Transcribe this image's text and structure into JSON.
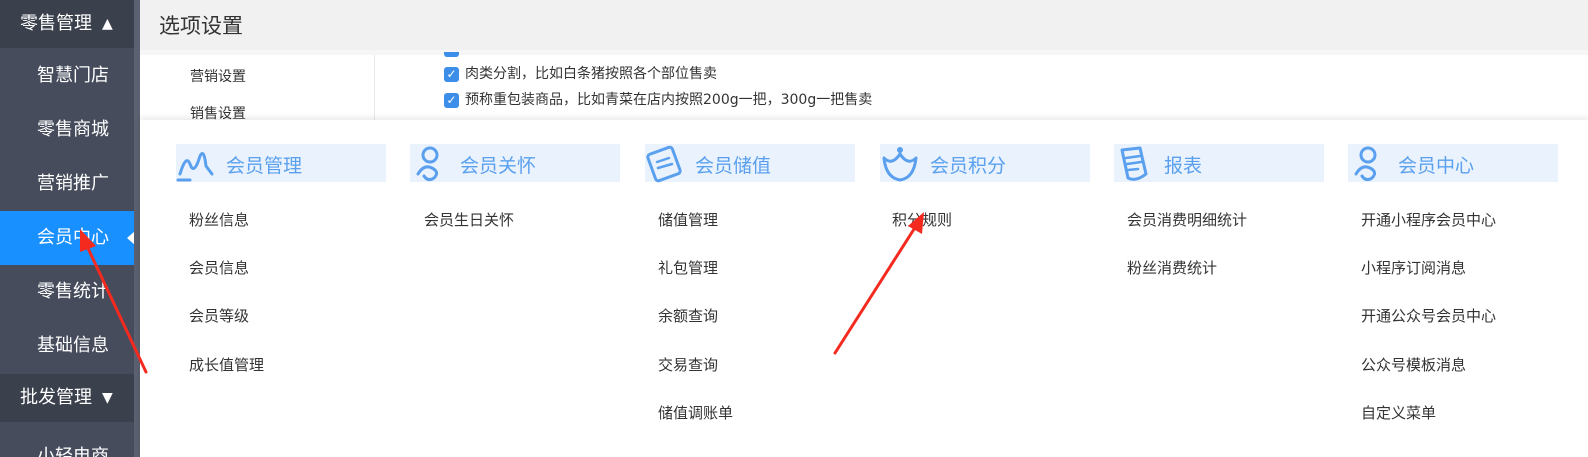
{
  "sidebar": {
    "retail_group": {
      "label": "零售管理",
      "arrow": "▲"
    },
    "items": [
      {
        "label": "智慧门店"
      },
      {
        "label": "零售商城"
      },
      {
        "label": "营销推广"
      },
      {
        "label": "会员中心"
      },
      {
        "label": "零售统计"
      },
      {
        "label": "基础信息"
      }
    ],
    "wholesale_group": {
      "label": "批发管理",
      "arrow": "▼"
    },
    "partial_item": {
      "label": "小轻电商"
    }
  },
  "header": {
    "title": "选项设置"
  },
  "settings": {
    "nav": [
      {
        "label": "营销设置"
      },
      {
        "label": "销售设置"
      }
    ],
    "options": [
      {
        "label": "肉类分割，比如白条猪按照各个部位售卖",
        "checked": true
      },
      {
        "label": "预称重包装商品，比如青菜在店内按照200g一把，300g一把售卖",
        "checked": true
      }
    ]
  },
  "mega_menu": {
    "columns": [
      {
        "title": "会员管理",
        "icon": "member-management-icon",
        "links": [
          "粉丝信息",
          "会员信息",
          "会员等级",
          "成长值管理"
        ]
      },
      {
        "title": "会员关怀",
        "icon": "member-care-icon",
        "links": [
          "会员生日关怀"
        ]
      },
      {
        "title": "会员储值",
        "icon": "member-stored-value-icon",
        "links": [
          "储值管理",
          "礼包管理",
          "余额查询",
          "交易查询",
          "储值调账单"
        ]
      },
      {
        "title": "会员积分",
        "icon": "member-points-icon",
        "links": [
          "积分规则"
        ]
      },
      {
        "title": "报表",
        "icon": "report-icon",
        "links": [
          "会员消费明细统计",
          "粉丝消费统计"
        ]
      },
      {
        "title": "会员中心",
        "icon": "member-center-icon",
        "links": [
          "开通小程序会员中心",
          "小程序订阅消息",
          "开通公众号会员中心",
          "公众号模板消息",
          "自定义菜单"
        ]
      }
    ]
  },
  "colors": {
    "sidebar_bg": "#464c5c",
    "sidebar_active": "#1890ff",
    "header_accent": "#5aa0ee",
    "header_bg": "#eaf3fd",
    "checkbox": "#3d8ee8",
    "annotation_arrow": "#f52a1f"
  }
}
